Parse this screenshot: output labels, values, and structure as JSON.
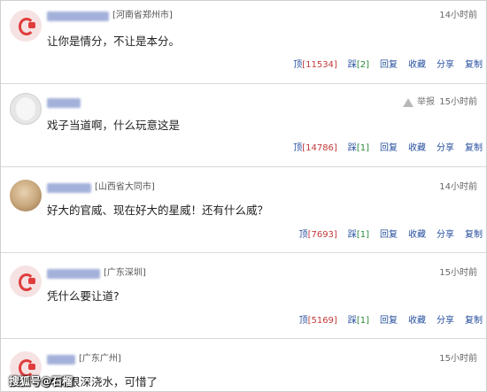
{
  "comments": [
    {
      "location": "[河南省郑州市]",
      "time": "14小时前",
      "text": "让你是情分，不让是本分。",
      "up_label": "顶",
      "up_count": "[11534]",
      "down_label": "踩",
      "down_count": "[2]",
      "reply": "回复",
      "collect": "收藏",
      "share": "分享",
      "copy": "复制"
    },
    {
      "location": "",
      "report": "举报",
      "time": "15小时前",
      "text": "戏子当道啊，什么玩意这是",
      "up_label": "顶",
      "up_count": "[14786]",
      "down_label": "踩",
      "down_count": "[1]",
      "reply": "回复",
      "collect": "收藏",
      "share": "分享",
      "copy": "复制"
    },
    {
      "location": "[山西省大同市]",
      "time": "14小时前",
      "text": "好大的官威、现在好大的星威！还有什么威？",
      "up_label": "顶",
      "up_count": "[7693]",
      "down_label": "踩",
      "down_count": "[1]",
      "reply": "回复",
      "collect": "收藏",
      "share": "分享",
      "copy": "复制"
    },
    {
      "location": "[广东深圳]",
      "time": "15小时前",
      "text": "凭什么要让道?",
      "up_label": "顶",
      "up_count": "[5169]",
      "down_label": "踩",
      "down_count": "[1]",
      "reply": "回复",
      "collect": "收藏",
      "share": "分享",
      "copy": "复制"
    },
    {
      "location": "[广东广州]",
      "time": "15小时前",
      "text": "大海很深浇水，可惜了"
    }
  ],
  "watermark": "搜狐号@石榴"
}
